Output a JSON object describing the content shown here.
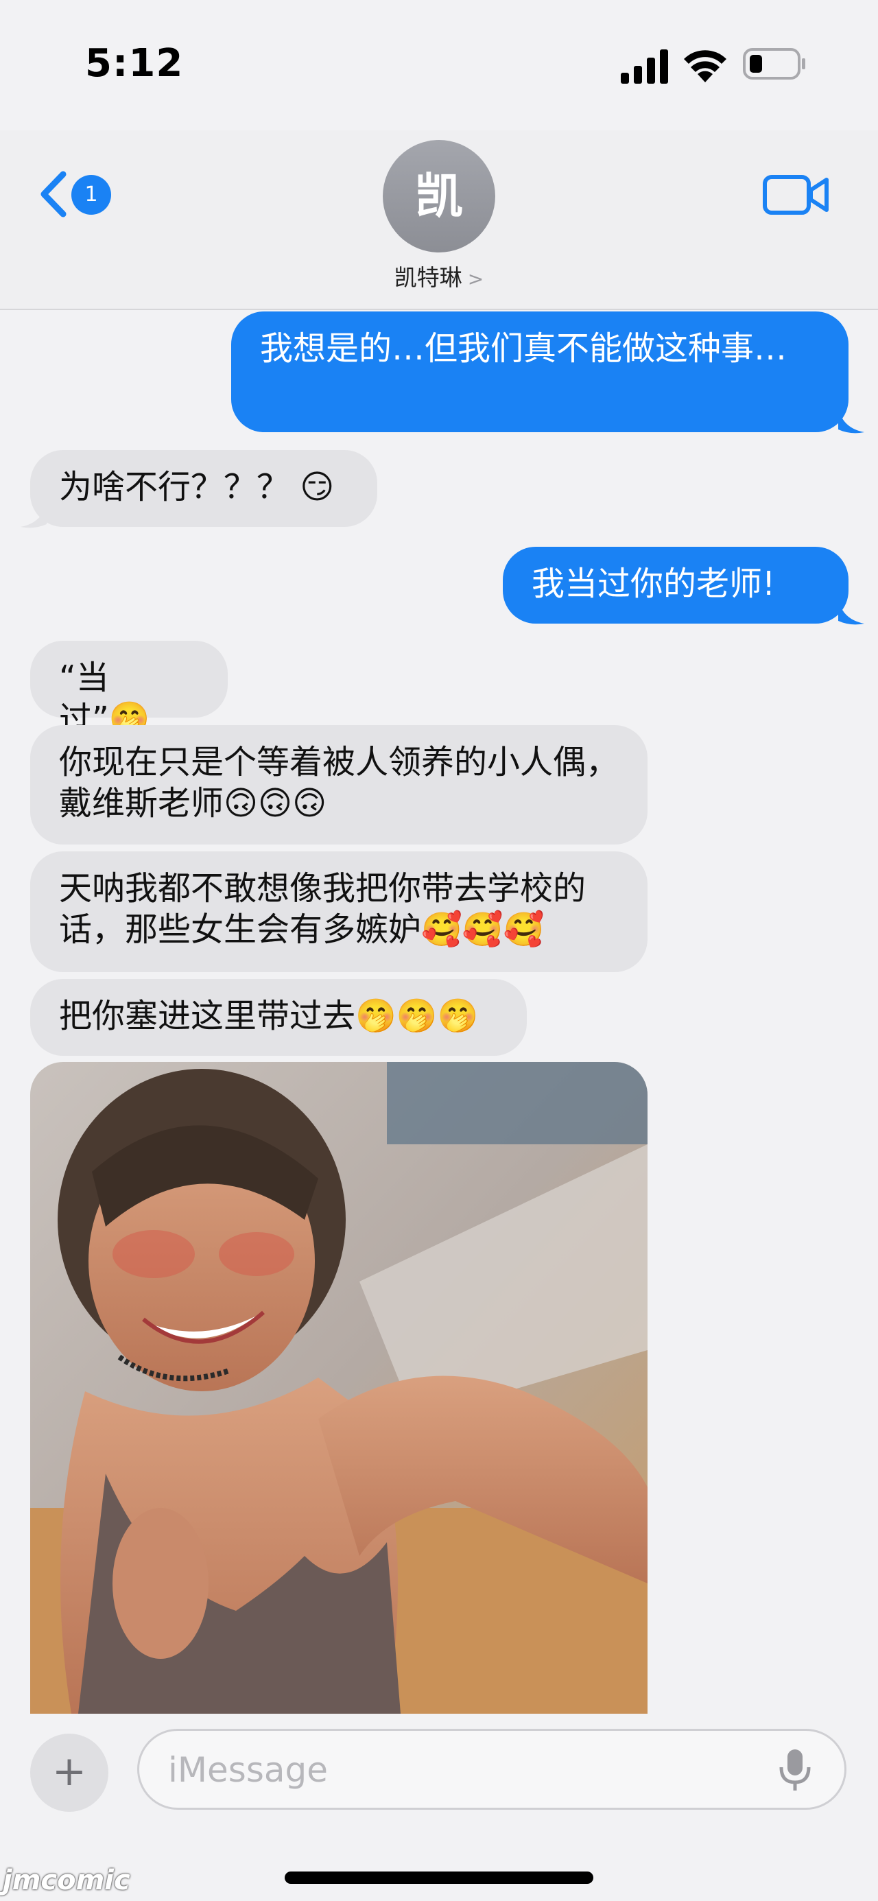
{
  "status_bar": {
    "time": "5:12"
  },
  "header": {
    "back_badge": "1",
    "avatar_initial": "凯",
    "contact_name": "凯特琳",
    "chevron": ">"
  },
  "messages": [
    {
      "from": "me",
      "text": "我想是的…但我们真不能做这种事…"
    },
    {
      "from": "them",
      "text": "为啥不行？？？ 😏"
    },
    {
      "from": "me",
      "text": "我当过你的老师!"
    },
    {
      "from": "them",
      "text": "“当过”🤭"
    },
    {
      "from": "them",
      "text": "你现在只是个等着被人领养的小人偶，戴维斯老师🙃🙃🙃"
    },
    {
      "from": "them",
      "text": "天呐我都不敢想像我把你带去学校的话，那些女生会有多嫉妒🥰🥰🥰"
    },
    {
      "from": "them",
      "text": "把你塞进这里带过去🤭🤭🤭"
    }
  ],
  "composer": {
    "placeholder": "iMessage"
  },
  "watermark": "jmcomic",
  "colors": {
    "blue": "#1a82f4",
    "gray_bubble": "#e3e3e6",
    "background": "#f2f2f4"
  }
}
